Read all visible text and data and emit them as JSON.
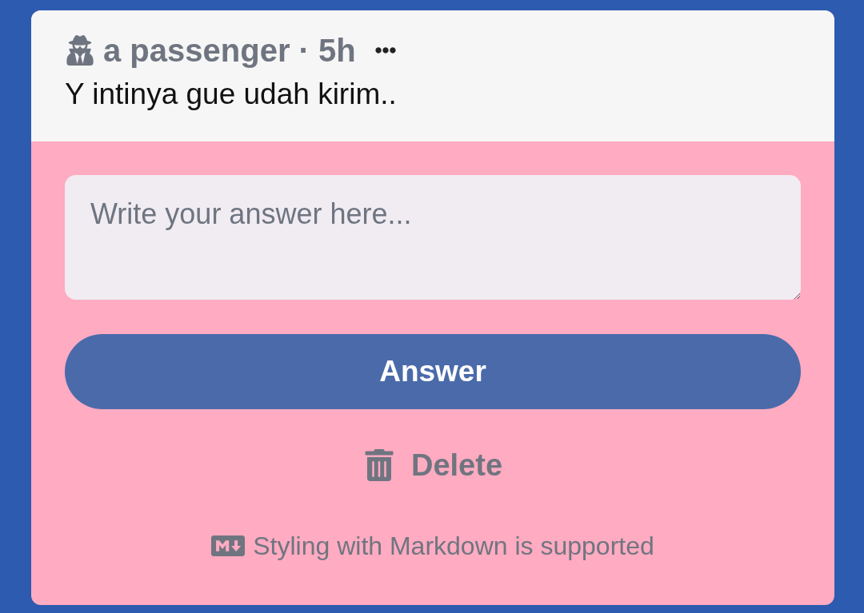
{
  "post": {
    "author_line": "a passenger · 5h",
    "text": "Y intinya gue udah kirim.."
  },
  "answer_form": {
    "placeholder": "Write your answer here...",
    "submit": "Answer",
    "delete": "Delete",
    "footer": "Styling with Markdown is supported"
  }
}
